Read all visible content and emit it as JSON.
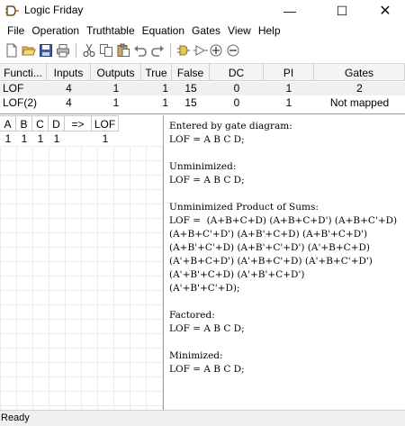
{
  "window": {
    "title": "Logic Friday",
    "min_glyph": "—",
    "max_glyph": "☐",
    "close_glyph": "✕"
  },
  "menu": [
    "File",
    "Operation",
    "Truthtable",
    "Equation",
    "Gates",
    "View",
    "Help"
  ],
  "toolbar": {
    "icons": [
      "new-icon",
      "open-icon",
      "save-icon",
      "print-icon",
      "cut-icon",
      "copy-icon",
      "paste-icon",
      "undo-icon",
      "redo-icon",
      "gate-and-icon",
      "gate-buffer-icon",
      "gate-or-icon",
      "gate-xor-icon"
    ]
  },
  "summary": {
    "headers": [
      "Functi...",
      "Inputs",
      "Outputs",
      "True",
      "False",
      "DC",
      "PI",
      "Gates"
    ],
    "rows": [
      [
        "LOF",
        "4",
        "1",
        "1",
        "15",
        "0",
        "1",
        "2"
      ],
      [
        "LOF(2)",
        "4",
        "1",
        "1",
        "15",
        "0",
        "1",
        "Not mapped"
      ]
    ]
  },
  "truthtable": {
    "headers": [
      "A",
      "B",
      "C",
      "D",
      "=>",
      "LOF"
    ],
    "rows": [
      [
        "1",
        "1",
        "1",
        "1",
        "",
        "1"
      ]
    ]
  },
  "output_text": [
    "Entered by gate diagram:",
    "LOF = A B C D;",
    "",
    "Unminimized:",
    "LOF = A B C D;",
    "",
    "Unminimized Product of Sums:",
    "LOF =  (A+B+C+D) (A+B+C+D') (A+B+C'+D)",
    "(A+B+C'+D') (A+B'+C+D) (A+B'+C+D')",
    "(A+B'+C'+D) (A+B'+C'+D') (A'+B+C+D)",
    "(A'+B+C+D') (A'+B+C'+D) (A'+B+C'+D')",
    "(A'+B'+C+D) (A'+B'+C+D')",
    "(A'+B'+C'+D);",
    "",
    "Factored:",
    "LOF = A B C D;",
    "",
    "Minimized:",
    "LOF = A B C D;"
  ],
  "status": "Ready",
  "colors": {
    "selected_row": "#f0f0f0",
    "header_bg": "#f4f4f4",
    "divider": "#a0a0a0"
  }
}
